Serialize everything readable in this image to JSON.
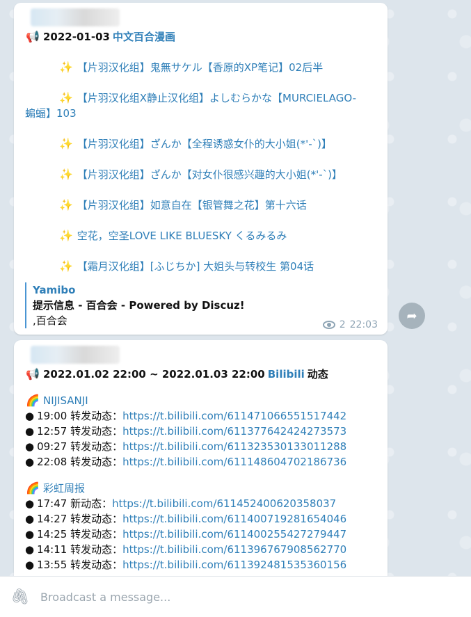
{
  "composer": {
    "placeholder": "Broadcast a message..."
  },
  "messages": [
    {
      "headline_date": "2022-01-03",
      "headline_link": "中文百合漫画",
      "posts": [
        "【片羽汉化组】鬼無サケル【香原的XP笔记】02后半",
        "【片羽汉化组X静止汉化组】よしむらかな【MURCIELAGO-",
        "蝙蝠】103",
        "【片羽汉化组】ざんか【全程诱惑女仆的大小姐(*'-`)】",
        "【片羽汉化组】ざんか【对女仆很感兴趣的大小姐(*'-`)】",
        "【片羽汉化组】如意自在【银管舞之花】第十六话",
        "空花，空圣LOVE LIKE BLUESKY くるみるみ",
        "【霜月汉化组】[ふじちか] 大姐头与转校生 第04话"
      ],
      "preview": {
        "site": "Yamibo",
        "title": "提示信息 -  百合会 -  Powered by Discuz!",
        "desc": ",百合会"
      },
      "views": "2",
      "time": "22:03"
    },
    {
      "headline_range": "2022.01.02 22:00 ~ 2022.01.03 22:00",
      "headline_link": "Bilibili",
      "headline_suffix": "动态",
      "sections": [
        {
          "name": "NIJISANJI",
          "entries": [
            {
              "time": "19:00",
              "type": "转发动态：",
              "url": "https://t.bilibili.com/611471066551517442"
            },
            {
              "time": "12:57",
              "type": "转发动态：",
              "url": "https://t.bilibili.com/611377642424273573"
            },
            {
              "time": "09:27",
              "type": "转发动态：",
              "url": "https://t.bilibili.com/611323530133011288"
            },
            {
              "time": "22:08",
              "type": "转发动态：",
              "url": "https://t.bilibili.com/611148604702186736"
            }
          ]
        },
        {
          "name": "彩虹周报",
          "entries": [
            {
              "time": "17:47",
              "type": "新动态：",
              "url": "https://t.bilibili.com/611452400620358037"
            },
            {
              "time": "14:27",
              "type": "转发动态：",
              "url": "https://t.bilibili.com/611400719281654046"
            },
            {
              "time": "14:25",
              "type": "转发动态：",
              "url": "https://t.bilibili.com/611400255427279447"
            },
            {
              "time": "14:11",
              "type": "转发动态：",
              "url": "https://t.bilibili.com/611396767908562770"
            },
            {
              "time": "13:55",
              "type": "转发动态：",
              "url": "https://t.bilibili.com/611392481535360156"
            }
          ]
        }
      ]
    }
  ],
  "icons": {
    "megaphone": "📢",
    "sparkles": "✨",
    "rainbow": "🌈",
    "eye": "eye-icon",
    "share": "share-arrow-icon",
    "attach": "paperclip-icon"
  },
  "colors": {
    "link": "#2f7fb8",
    "meta": "#8ea4b4"
  }
}
